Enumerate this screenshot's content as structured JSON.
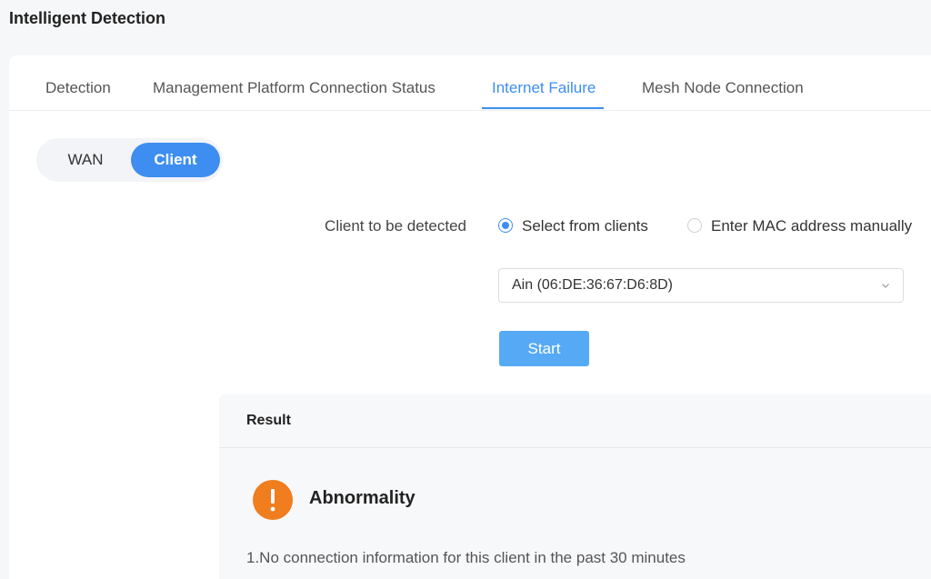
{
  "page": {
    "title": "Intelligent Detection"
  },
  "tabs": [
    {
      "label": "Detection",
      "active": false
    },
    {
      "label": "Management Platform Connection Status",
      "active": false
    },
    {
      "label": "Internet Failure",
      "active": true
    },
    {
      "label": "Mesh Node Connection",
      "active": false
    }
  ],
  "segment": {
    "wan_label": "WAN",
    "client_label": "Client",
    "selected": "Client"
  },
  "form": {
    "client_label": "Client to be detected",
    "option_select": "Select from clients",
    "option_manual": "Enter MAC address manually",
    "selected_option": "Select from clients",
    "client_value": "Ain (06:DE:36:67:D6:8D)",
    "start_label": "Start"
  },
  "result": {
    "title": "Result",
    "status": "Abnormality",
    "detail": "1.No connection information for this client in the past 30 minutes"
  },
  "colors": {
    "accent": "#3d8ef0",
    "start_button": "#56aaf5",
    "warning": "#f07d1e"
  },
  "icons": {
    "select_chevron": "chevron-down-icon",
    "result_status": "exclamation-icon"
  }
}
